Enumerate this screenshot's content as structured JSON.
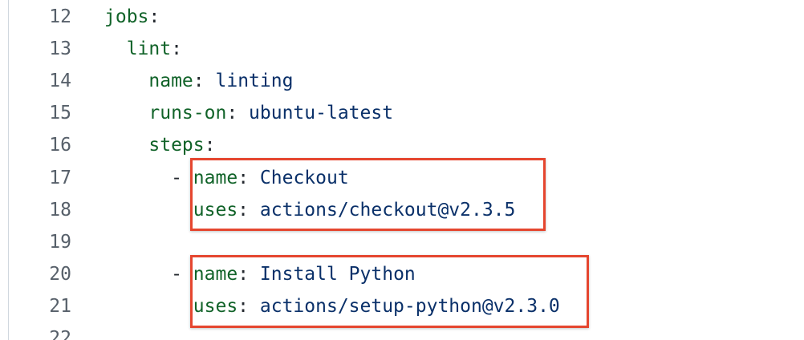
{
  "lines": [
    {
      "num": "12",
      "indent": "",
      "dash": "",
      "key": "jobs",
      "value": ""
    },
    {
      "num": "13",
      "indent": "  ",
      "dash": "",
      "key": "lint",
      "value": ""
    },
    {
      "num": "14",
      "indent": "    ",
      "dash": "",
      "key": "name",
      "value": "linting"
    },
    {
      "num": "15",
      "indent": "    ",
      "dash": "",
      "key": "runs-on",
      "value": "ubuntu-latest"
    },
    {
      "num": "16",
      "indent": "    ",
      "dash": "",
      "key": "steps",
      "value": ""
    },
    {
      "num": "17",
      "indent": "      ",
      "dash": "- ",
      "key": "name",
      "value": "Checkout"
    },
    {
      "num": "18",
      "indent": "        ",
      "dash": "",
      "key": "uses",
      "value": "actions/checkout@v2.3.5"
    },
    {
      "num": "19",
      "indent": "",
      "dash": "",
      "key": "",
      "value": ""
    },
    {
      "num": "20",
      "indent": "      ",
      "dash": "- ",
      "key": "name",
      "value": "Install Python"
    },
    {
      "num": "21",
      "indent": "        ",
      "dash": "",
      "key": "uses",
      "value": "actions/setup-python@v2.3.0"
    },
    {
      "num": "22",
      "indent": "",
      "dash": "",
      "key": "",
      "value": ""
    }
  ],
  "highlight_color": "#e5462f",
  "colors": {
    "key": "#116329",
    "value": "#0a3069",
    "line_number": "#57606a"
  }
}
